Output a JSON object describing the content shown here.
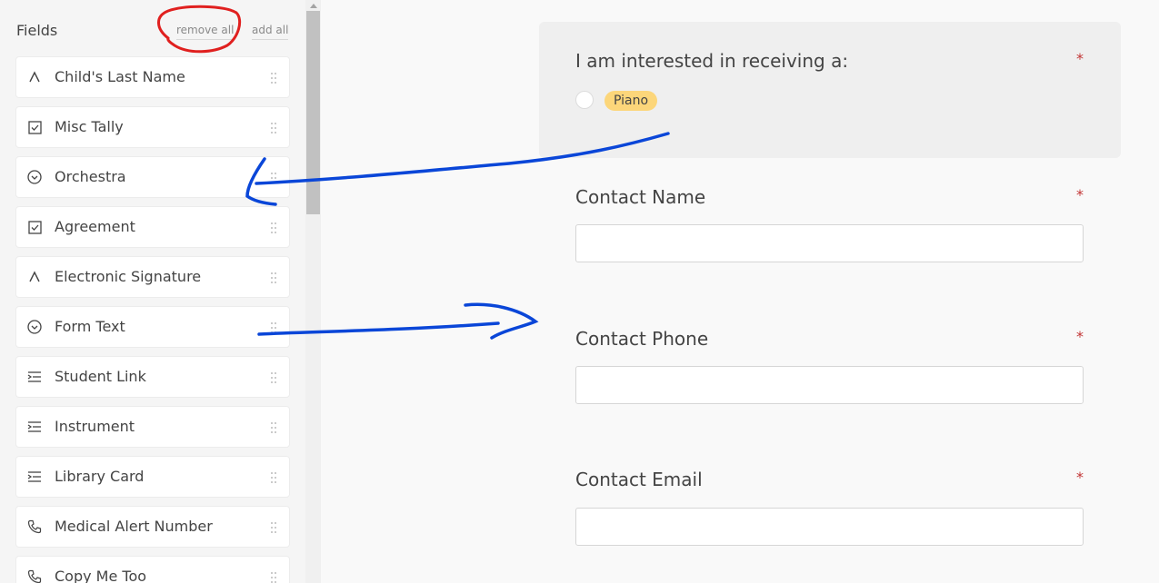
{
  "sidebar": {
    "title": "Fields",
    "remove_all": "remove all",
    "add_all": "add all",
    "items": [
      {
        "label": "Child's Last Name",
        "icon": "text-a-icon"
      },
      {
        "label": "Misc Tally",
        "icon": "checkbox-icon"
      },
      {
        "label": "Orchestra",
        "icon": "dropdown-circle-icon"
      },
      {
        "label": "Agreement",
        "icon": "checkbox-icon"
      },
      {
        "label": "Electronic Signature",
        "icon": "text-a-icon"
      },
      {
        "label": "Form Text",
        "icon": "dropdown-circle-icon"
      },
      {
        "label": "Student Link",
        "icon": "link-list-icon"
      },
      {
        "label": "Instrument",
        "icon": "link-list-icon"
      },
      {
        "label": "Library Card",
        "icon": "link-list-icon"
      },
      {
        "label": "Medical Alert Number",
        "icon": "phone-icon"
      },
      {
        "label": "Copy Me Too",
        "icon": "phone-icon"
      }
    ]
  },
  "form": {
    "interest_question": "I am interested in receiving a:",
    "interest_option": "Piano",
    "contact_name_label": "Contact Name",
    "contact_phone_label": "Contact Phone",
    "contact_email_label": "Contact Email",
    "required_marker": "*",
    "contact_name_value": "",
    "contact_phone_value": "",
    "contact_email_value": ""
  },
  "colors": {
    "required": "#c23434",
    "chip": "#fcd67a",
    "annotation_red": "#e0201f",
    "annotation_blue": "#0a46d8"
  }
}
